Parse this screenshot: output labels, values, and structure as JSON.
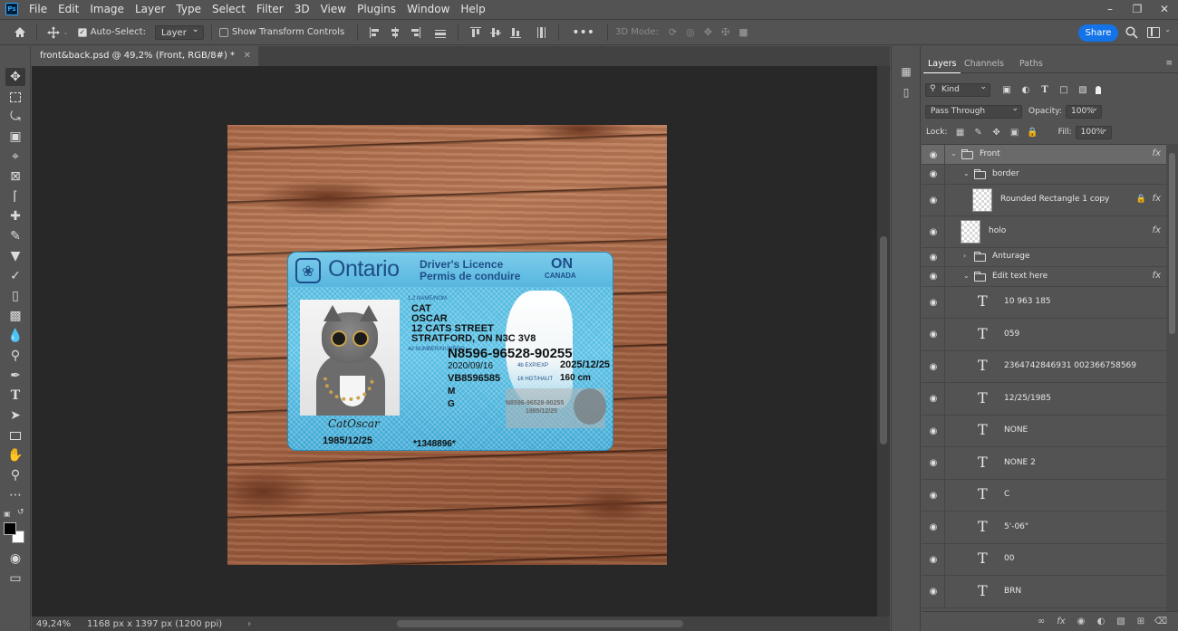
{
  "app": {
    "logo": "Ps"
  },
  "menu": [
    "File",
    "Edit",
    "Image",
    "Layer",
    "Type",
    "Select",
    "Filter",
    "3D",
    "View",
    "Plugins",
    "Window",
    "Help"
  ],
  "options": {
    "auto_select_label": "Auto-Select:",
    "auto_select_value": "Layer",
    "transform_label": "Show Transform Controls",
    "three_d_label": "3D Mode:",
    "share_label": "Share"
  },
  "document": {
    "tab_title": "front&back.psd @ 49,2% (Front, RGB/8#) *",
    "zoom": "49,24%",
    "doc_size": "1168 px x 1397 px (1200 ppi)"
  },
  "license": {
    "province": "Ontario",
    "title_en": "Driver's Licence",
    "title_fr": "Permis de conduire",
    "code": "ON",
    "country": "CANADA",
    "last_name": "CAT",
    "first_name": "OSCAR",
    "street": "12 CATS STREET",
    "city": "STRATFORD, ON N3C 3V8",
    "number": "N8596-96528-90255",
    "issue_date": "2020/09/16",
    "expiry_label": "4b EXP/EXP",
    "expiry": "2025/12/25",
    "dd": "VB8596585",
    "height_label": "16 HGT/HAUT",
    "height": "160 cm",
    "sex": "M",
    "class": "G",
    "signature": "CatOscar",
    "dob": "1985/12/25",
    "ref": "*1348896*",
    "ghost_number": "N8596-96528-90255",
    "ghost_dob": "1985/12/25",
    "label_name": "1,2 NAME/NOM",
    "label_number": "4d NUMBER/NUMÉRO"
  },
  "panel": {
    "tabs": [
      "Layers",
      "Channels",
      "Paths"
    ],
    "filter_kind": "Kind",
    "blend_mode": "Pass Through",
    "opacity_label": "Opacity:",
    "opacity": "100%",
    "lock_label": "Lock:",
    "fill_label": "Fill:",
    "fill": "100%"
  },
  "layers": [
    {
      "name": "Front",
      "type": "group",
      "depth": 0,
      "open": true,
      "fx": true,
      "selected": true
    },
    {
      "name": "border",
      "type": "group",
      "depth": 1,
      "open": true,
      "fx": false
    },
    {
      "name": "Rounded Rectangle 1 copy",
      "type": "shape",
      "depth": 2,
      "fx": true,
      "locked": true
    },
    {
      "name": "holo",
      "type": "pixel",
      "depth": 1,
      "fx": true
    },
    {
      "name": "Anturage",
      "type": "group",
      "depth": 1,
      "open": false,
      "fx": false
    },
    {
      "name": "Edit text here",
      "type": "group",
      "depth": 1,
      "open": true,
      "fx": true
    },
    {
      "name": "10 963 185",
      "type": "text",
      "depth": 2
    },
    {
      "name": "059",
      "type": "text",
      "depth": 2
    },
    {
      "name": "2364742846931 002366758569",
      "type": "text",
      "depth": 2
    },
    {
      "name": "12/25/1985",
      "type": "text",
      "depth": 2
    },
    {
      "name": "NONE",
      "type": "text",
      "depth": 2
    },
    {
      "name": "NONE 2",
      "type": "text",
      "depth": 2
    },
    {
      "name": "C",
      "type": "text",
      "depth": 2
    },
    {
      "name": "5'-06\"",
      "type": "text",
      "depth": 2
    },
    {
      "name": "00",
      "type": "text",
      "depth": 2
    },
    {
      "name": "BRN",
      "type": "text",
      "depth": 2
    }
  ],
  "colors": {
    "accent": "#1473e6",
    "ui_bg": "#535353",
    "canvas_bg": "#282828"
  }
}
